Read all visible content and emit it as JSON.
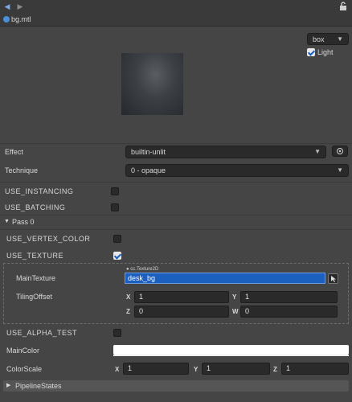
{
  "toolbar": {
    "back_icon": "back-arrow-icon",
    "forward_icon": "forward-arrow-icon",
    "lock_icon": "lock-icon"
  },
  "file": {
    "name": "bg.mtl"
  },
  "preview": {
    "shape_value": "box",
    "light_label": "Light",
    "light_checked": true
  },
  "effect": {
    "label": "Effect",
    "value": "builtin-unlit"
  },
  "technique": {
    "label": "Technique",
    "value": "0 - opaque"
  },
  "flags": {
    "instancing": {
      "label": "USE_INSTANCING",
      "checked": false
    },
    "batching": {
      "label": "USE_BATCHING",
      "checked": false
    }
  },
  "pass": {
    "label": "Pass 0",
    "vertex_color": {
      "label": "USE_VERTEX_COLOR",
      "checked": false
    },
    "texture": {
      "label": "USE_TEXTURE",
      "checked": true
    },
    "main_texture": {
      "label": "MainTexture",
      "type_tag": "cc.Texture2D",
      "value": "desk_bg"
    },
    "tiling_offset": {
      "label": "TilingOffset",
      "x": {
        "axis": "X",
        "value": "1"
      },
      "y": {
        "axis": "Y",
        "value": "1"
      },
      "z": {
        "axis": "Z",
        "value": "0"
      },
      "w": {
        "axis": "W",
        "value": "0"
      }
    },
    "alpha_test": {
      "label": "USE_ALPHA_TEST",
      "checked": false
    },
    "main_color": {
      "label": "MainColor",
      "value": "#ffffff"
    },
    "color_scale": {
      "label": "ColorScale",
      "x": {
        "axis": "X",
        "value": "1"
      },
      "y": {
        "axis": "Y",
        "value": "1"
      },
      "z": {
        "axis": "Z",
        "value": "1"
      }
    }
  },
  "pipeline_states": {
    "label": "PipelineStates"
  },
  "colors": {
    "background": "#454545",
    "field": "#2a2a2a",
    "accent": "#1b5fbf"
  }
}
